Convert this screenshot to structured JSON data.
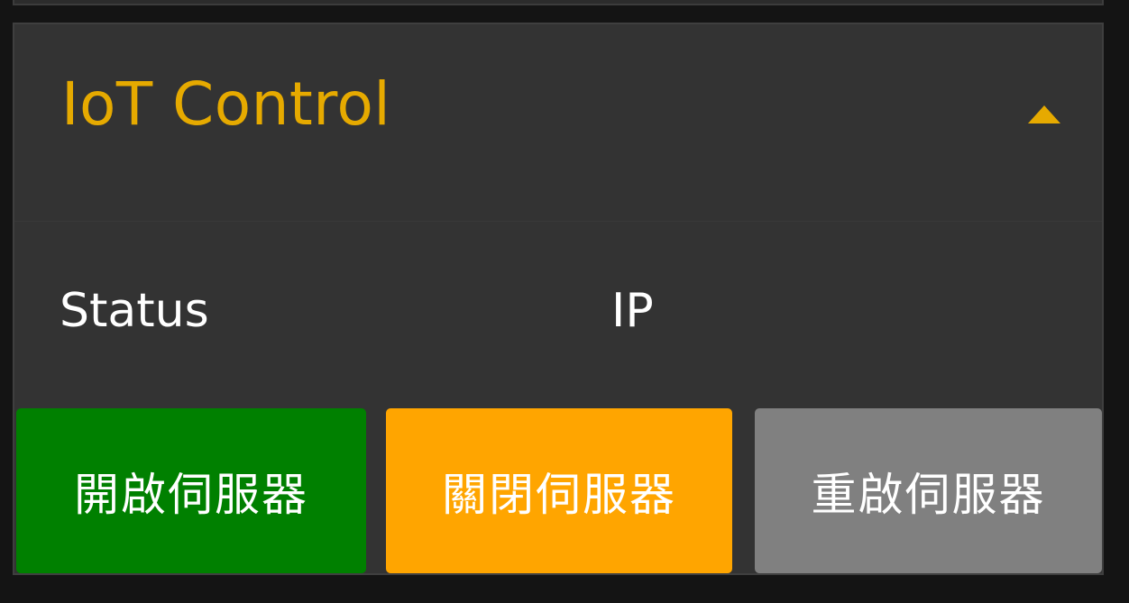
{
  "panel": {
    "title": "IoT Control",
    "toggle_icon": "caret-up-icon"
  },
  "info": {
    "status_label": "Status",
    "ip_label": "IP"
  },
  "buttons": {
    "start_label": "開啟伺服器",
    "stop_label": "關閉伺服器",
    "restart_label": "重啟伺服器"
  },
  "colors": {
    "accent": "#e6aa00",
    "panel_bg": "#333333",
    "start": "#008000",
    "stop": "#ffa500",
    "restart": "#808080"
  }
}
